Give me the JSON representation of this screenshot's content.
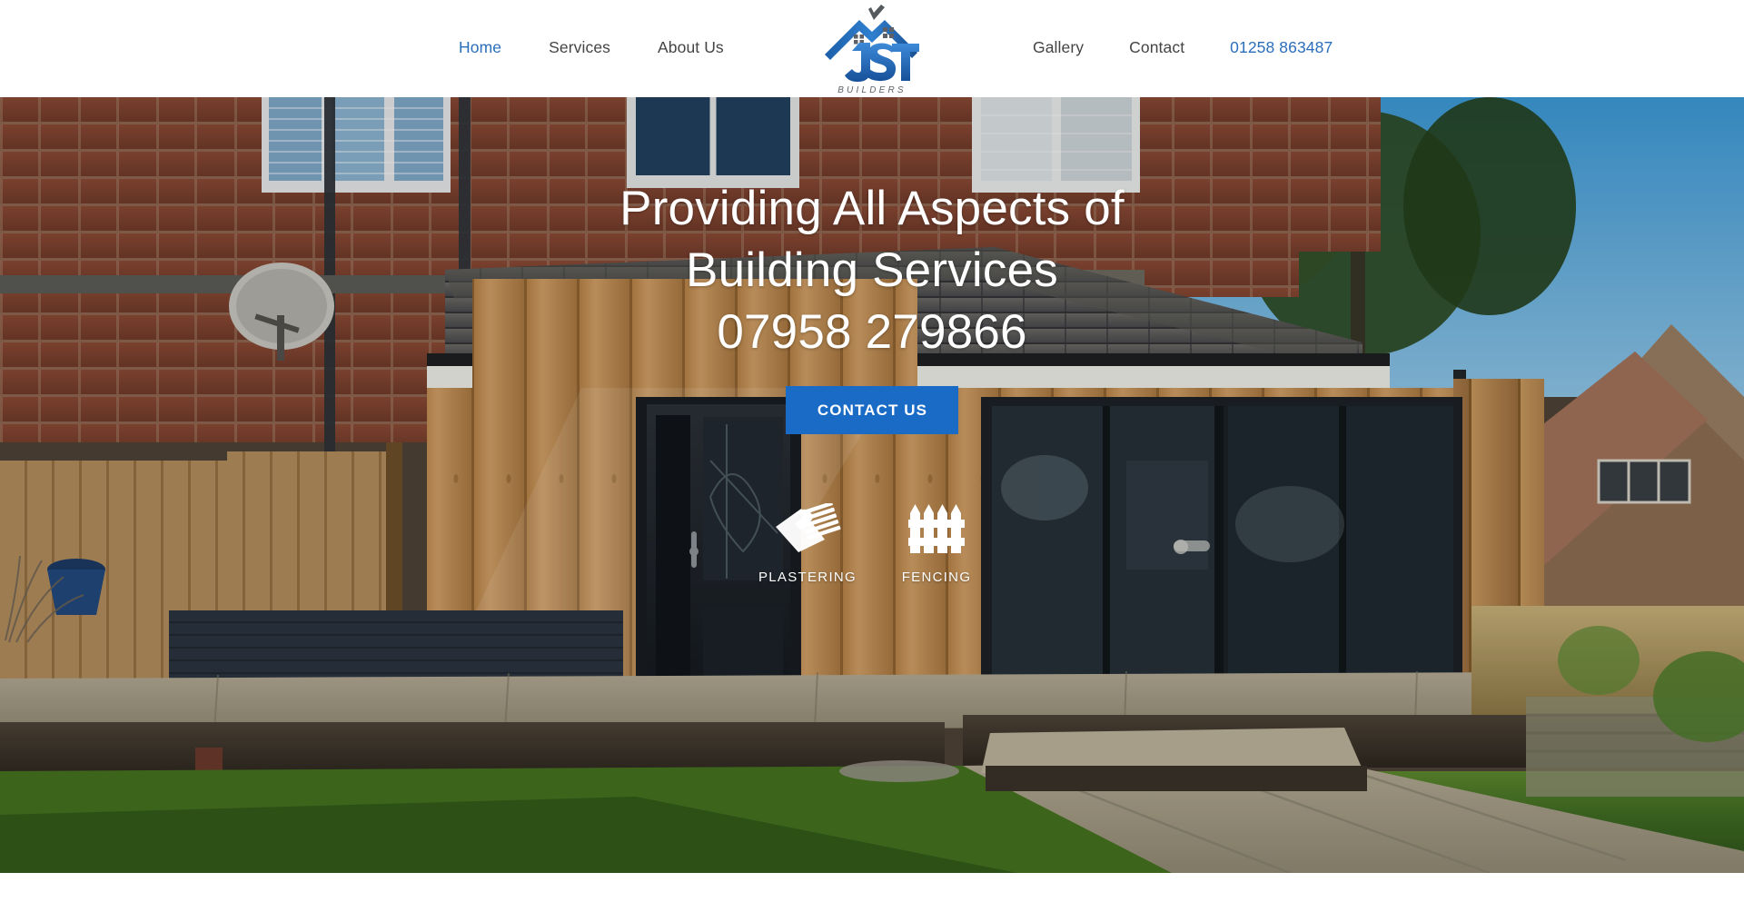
{
  "site": {
    "brand_name": "JST",
    "brand_sub": "BUILDERS",
    "logo_alt": "JST Builders house logo"
  },
  "header": {
    "nav_left": [
      {
        "label": "Home",
        "state": "active"
      },
      {
        "label": "Services",
        "state": "default"
      },
      {
        "label": "About Us",
        "state": "default"
      }
    ],
    "nav_right": [
      {
        "label": "Gallery",
        "state": "default"
      },
      {
        "label": "Contact",
        "state": "default"
      },
      {
        "label": "01258 863487",
        "state": "phone"
      }
    ]
  },
  "hero": {
    "headline_line1": "Providing All Aspects of",
    "headline_line2": "Building Services",
    "phone": "07958 279866",
    "cta_label": "CONTACT US",
    "services": [
      {
        "label": "PLASTERING",
        "icon": "trowel-icon"
      },
      {
        "label": "FENCING",
        "icon": "picket-fence-icon"
      }
    ],
    "background_alt": "Rear of brick house with new timber-clad extension, patio and lawn"
  },
  "colors": {
    "accent_blue": "#1a6bc6",
    "link_blue": "#2a6ebb",
    "nav_text": "#444444",
    "hero_text": "#ffffff",
    "header_bg": "#ffffff"
  }
}
